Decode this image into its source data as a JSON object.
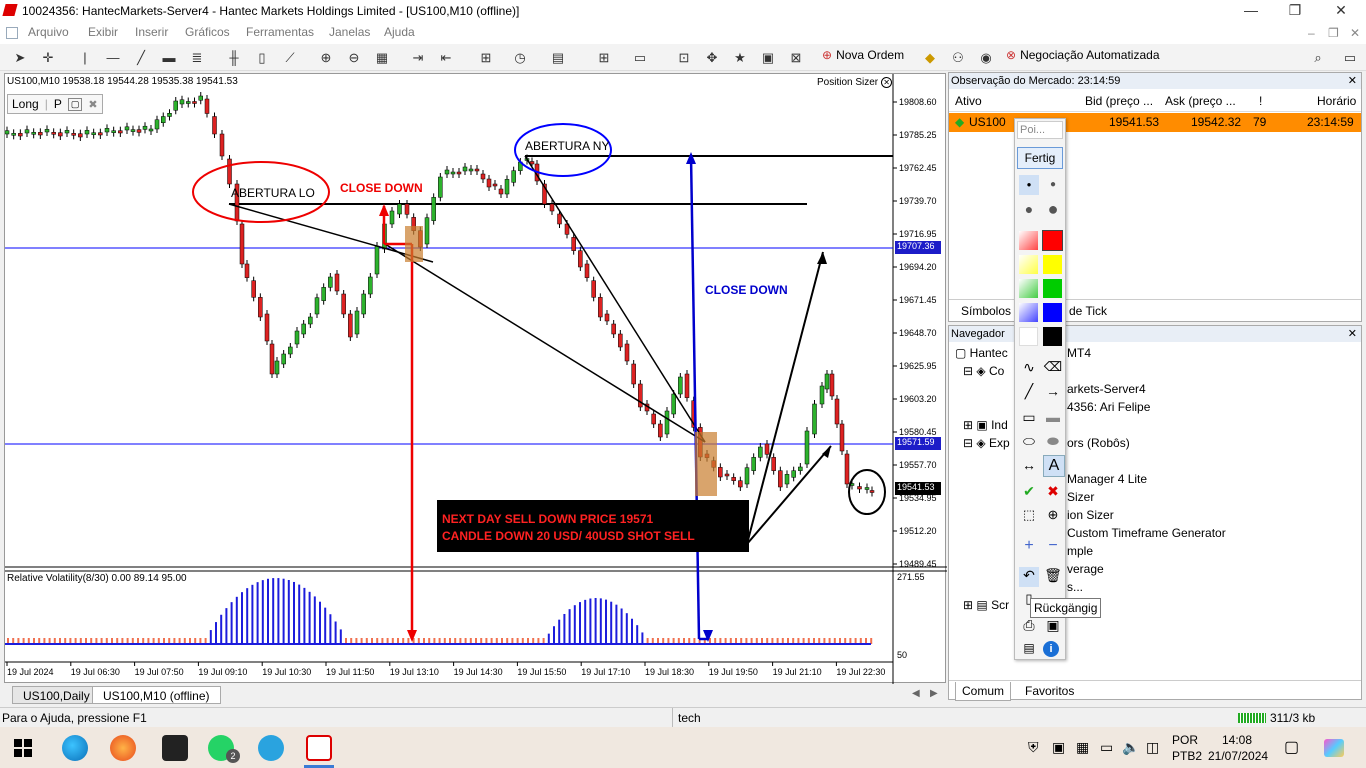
{
  "window": {
    "title": "10024356: HantecMarkets-Server4 - Hantec Markets Holdings Limited - [US100,M10 (offline)]",
    "minimize": "—",
    "maximize": "❐",
    "close": "✕"
  },
  "menu": [
    "Arquivo",
    "Exibir",
    "Inserir",
    "Gráficos",
    "Ferramentas",
    "Janelas",
    "Ajuda"
  ],
  "toolbar": {
    "new_order": "Nova Ordem",
    "auto_trading": "Negociação Automatizada"
  },
  "chart": {
    "header": "US100,M10  19538.18  19544.28  19535.38  19541.53",
    "position_sizer": "Position Sizer",
    "panel_long": "Long",
    "panel_p": "P",
    "indicator_label": "Relative Volatility(8/30) 0.00 89.14 95.00",
    "ind_top": "271.55",
    "ind_bottom": "50",
    "price_ticks": [
      "19808.60",
      "19785.25",
      "19762.45",
      "19739.70",
      "19716.95",
      "19694.20",
      "19671.45",
      "19648.70",
      "19625.95",
      "19603.20",
      "19580.45",
      "19557.70",
      "19534.95",
      "19512.20",
      "19489.45"
    ],
    "price_tags": {
      "blue_line_1": "19707.36",
      "blue_line_2": "19571.59",
      "current": "19541.53"
    },
    "time_ticks": [
      "19 Jul 2024",
      "19 Jul 06:30",
      "19 Jul 07:50",
      "19 Jul 09:10",
      "19 Jul 10:30",
      "19 Jul 11:50",
      "19 Jul 13:10",
      "19 Jul 14:30",
      "19 Jul 15:50",
      "19 Jul 17:10",
      "19 Jul 18:30",
      "19 Jul 19:50",
      "19 Jul 21:10",
      "19 Jul 22:30"
    ],
    "annotations": {
      "abertura_lo": "ABERTURA LO",
      "abertura_ny": "ABERTURA NY",
      "close_down_red": "CLOSE DOWN",
      "close_down_blue": "CLOSE DOWN",
      "box_line1": "NEXT DAY SELL DOWN PRICE 19571",
      "box_line2": "CANDLE DOWN 20 USD/ 40USD SHOT SELL"
    }
  },
  "chart_tabs": [
    "US100,Daily",
    "US100,M10 (offline)"
  ],
  "market_watch": {
    "title": "Observação do Mercado: 23:14:59",
    "columns": [
      "Ativo",
      "Bid (preço ...",
      "Ask (preço ...",
      "!",
      "Horário"
    ],
    "row": {
      "symbol": "US100",
      "bid": "19541.53",
      "ask": "19542.32",
      "spread": "79",
      "time": "23:14:59"
    },
    "tabs": [
      "Símbolos",
      "de Tick"
    ]
  },
  "navigator": {
    "title": "Navegador",
    "items": [
      "Hantec",
      "MT4",
      "Co",
      "arkets-Server4",
      "4356: Ari Felipe",
      "Ind",
      "Exp",
      "ors (Robôs)",
      "Manager 4 Lite",
      "Sizer",
      "ion Sizer",
      "Custom Timeframe Generator",
      "mple",
      "verage",
      "s...",
      "Scr"
    ],
    "tabs": [
      "Comum",
      "Favoritos"
    ]
  },
  "palette": {
    "search": "Poi...",
    "fertig": "Fertig",
    "tooltip": "Rückgängig"
  },
  "status": {
    "help": "Para o Ajuda, pressione F1",
    "profile": "tech",
    "traffic": "311/3 kb"
  },
  "taskbar": {
    "lang1": "POR",
    "lang2": "PTB2",
    "time": "14:08",
    "date": "21/07/2024",
    "whatsapp_badge": "2"
  }
}
